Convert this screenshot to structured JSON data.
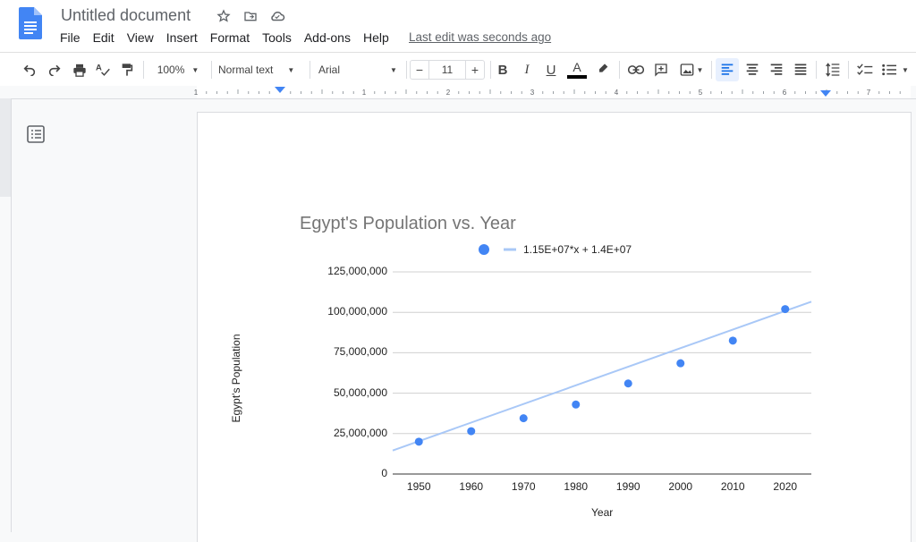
{
  "app": {
    "doc_title": "Untitled document",
    "menu": [
      "File",
      "Edit",
      "View",
      "Insert",
      "Format",
      "Tools",
      "Add-ons",
      "Help"
    ],
    "last_edit": "Last edit was seconds ago"
  },
  "toolbar": {
    "zoom": "100%",
    "style": "Normal text",
    "font": "Arial",
    "font_size": "11",
    "minus": "−",
    "plus": "+",
    "bold": "B",
    "italic": "I",
    "underline": "U",
    "text_color_letter": "A"
  },
  "ruler": {
    "labels": [
      "1",
      "1",
      "2",
      "3",
      "4",
      "5",
      "6",
      "7"
    ]
  },
  "colors": {
    "accent": "#4285f4",
    "trendline": "#a9c8f7",
    "text": "#202124"
  },
  "chart_data": {
    "type": "scatter",
    "title": "Egypt's Population vs. Year",
    "xlabel": "Year",
    "ylabel": "Egypt's Population",
    "x": [
      1950,
      1960,
      1970,
      1980,
      1990,
      2000,
      2010,
      2020
    ],
    "y": [
      20000000,
      26500000,
      34500000,
      43000000,
      56000000,
      68500000,
      82500000,
      102000000
    ],
    "x_ticks": [
      "1950",
      "1960",
      "1970",
      "1980",
      "1990",
      "2000",
      "2010",
      "2020"
    ],
    "y_ticks": [
      "125,000,000",
      "100,000,000",
      "75,000,000",
      "50,000,000",
      "25,000,000",
      "0"
    ],
    "ylim": [
      0,
      125000000
    ],
    "xlim": [
      1945,
      2025
    ],
    "trendline": {
      "label": "1.15E+07*x + 1.4E+07",
      "slope_per_step": 11500000,
      "intercept": 14000000
    },
    "legend_position": "top",
    "grid": true
  }
}
